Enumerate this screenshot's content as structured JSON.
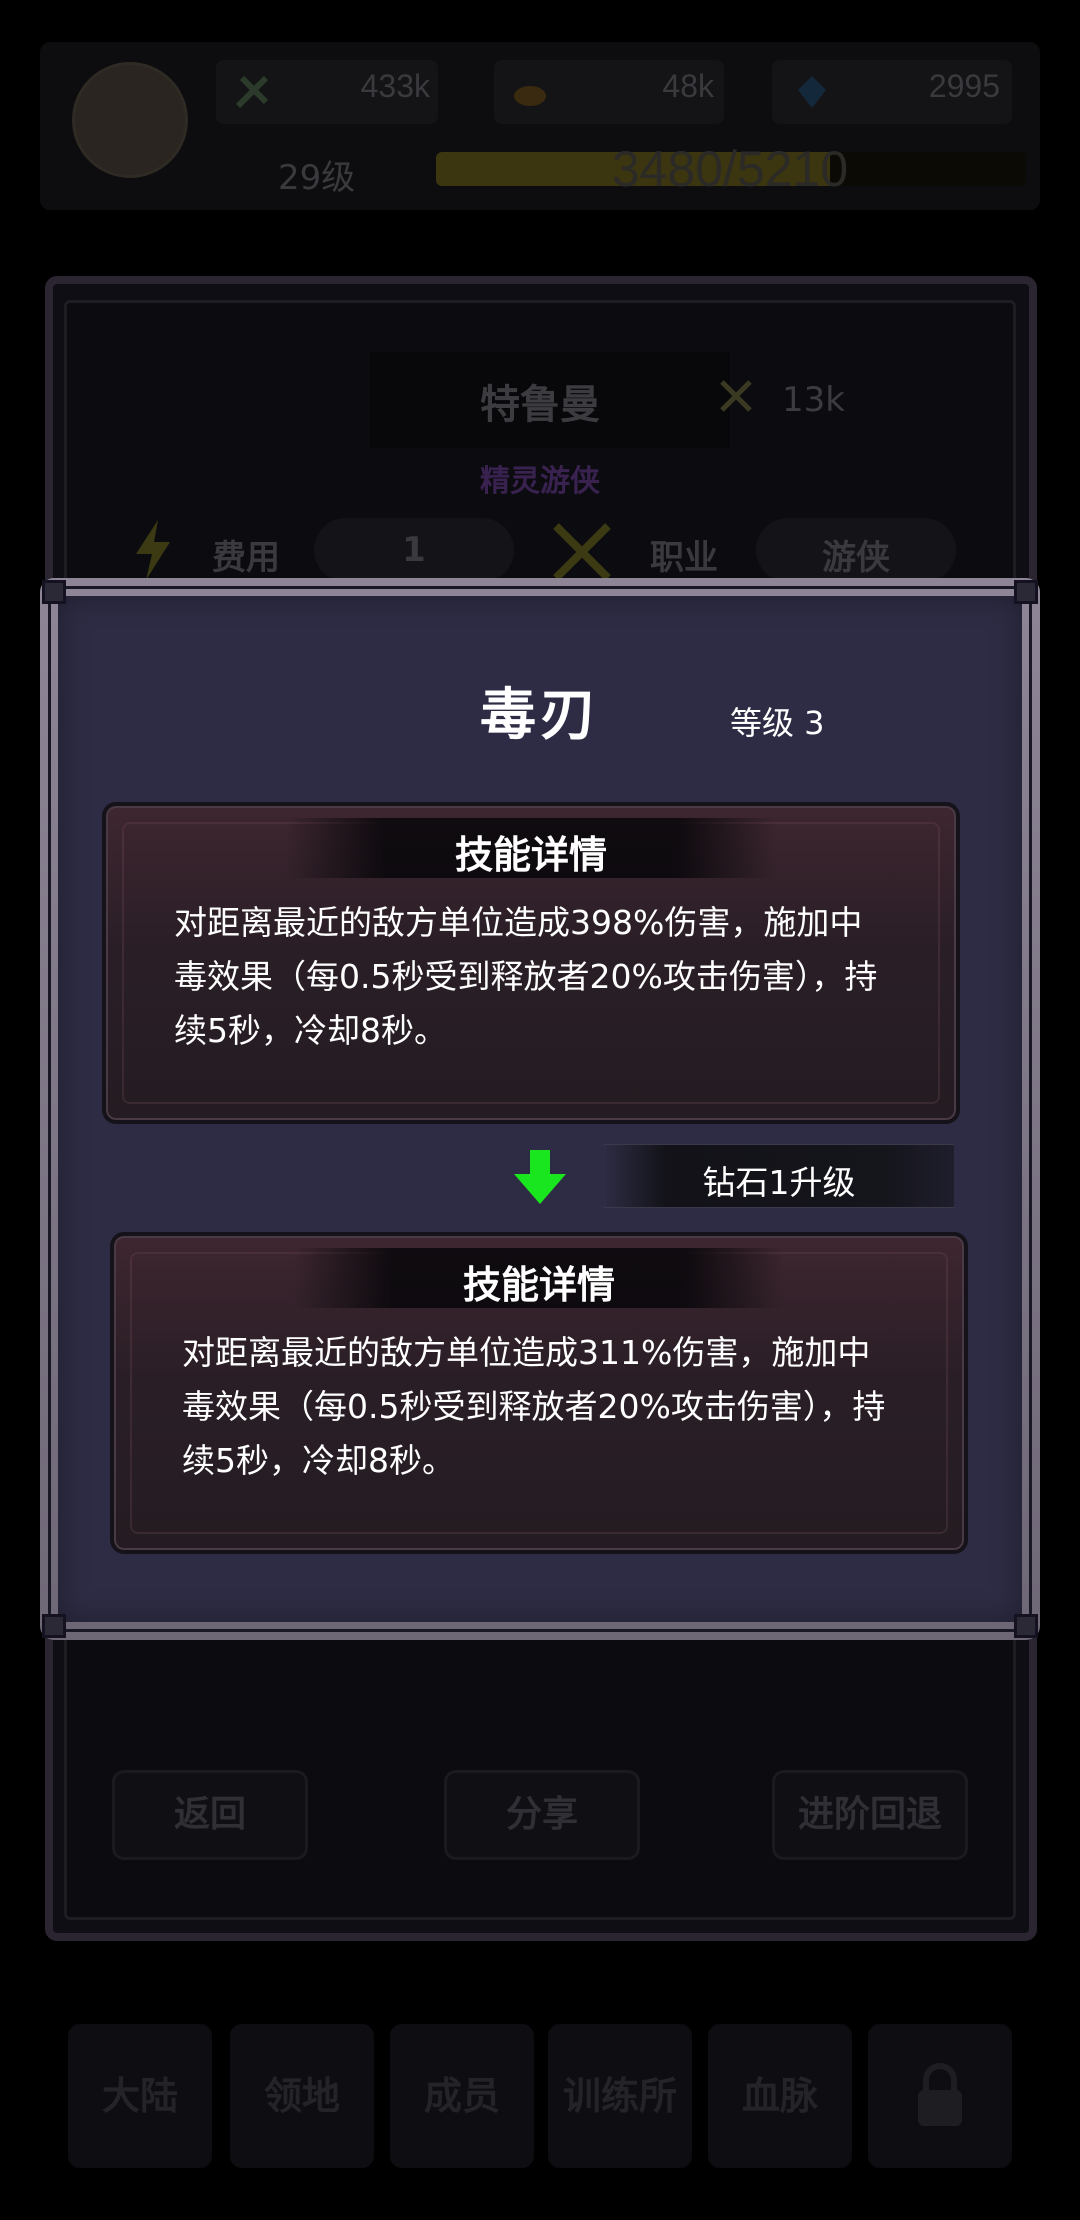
{
  "header": {
    "resources": [
      {
        "icon": "power-icon",
        "value": "433k"
      },
      {
        "icon": "gold-icon",
        "value": "48k"
      },
      {
        "icon": "diamond-icon",
        "value": "2995"
      }
    ],
    "level": "29级",
    "xp": {
      "current": 3480,
      "max": 5210,
      "text": "3480/5210"
    }
  },
  "hero": {
    "name": "特鲁曼",
    "power": "13k",
    "class": "精灵游侠",
    "cost_label": "费用",
    "cost_value": "1",
    "job_label": "职业",
    "job_value": "游侠"
  },
  "actions": {
    "back": "返回",
    "share": "分享",
    "regress": "进阶回退"
  },
  "bottom_nav": [
    "大陆",
    "领地",
    "成员",
    "训练所",
    "血脉",
    "锁"
  ],
  "popup": {
    "title": "毒刃",
    "level": "等级 3",
    "current": {
      "header": "技能详情",
      "text": "对距离最近的敌方单位造成398%伤害，施加中毒效果（每0.5秒受到释放者20%攻击伤害），持续5秒，冷却8秒。"
    },
    "upgrade_hint": "钻石1升级",
    "next": {
      "header": "技能详情",
      "text": "对距离最近的敌方单位造成311%伤害，施加中毒效果（每0.5秒受到释放者20%攻击伤害），持续5秒，冷却8秒。"
    }
  },
  "colors": {
    "popup_bg": "#2e2c44",
    "card_bg": "#2a1e26",
    "arrow_green": "#19e61e"
  }
}
